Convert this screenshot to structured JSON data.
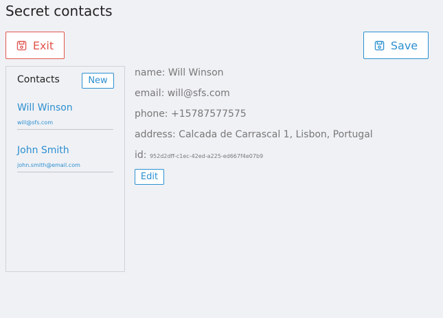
{
  "page": {
    "title": "Secret contacts"
  },
  "toolbar": {
    "exit_label": "Exit",
    "save_label": "Save",
    "exit_icon": "save-icon",
    "save_icon": "save-icon"
  },
  "sidebar": {
    "header": "Contacts",
    "new_label": "New",
    "contacts": [
      {
        "name": "Will Winson",
        "email": "will@sfs.com"
      },
      {
        "name": "John Smith",
        "email": "john.smith@email.com"
      }
    ]
  },
  "details": {
    "name_label": "name:",
    "name_value": "Will Winson",
    "email_label": "email:",
    "email_value": "will@sfs.com",
    "phone_label": "phone:",
    "phone_value": "+15787577575",
    "address_label": "address:",
    "address_value": "Calcada de Carrascal 1, Lisbon, Portugal",
    "id_label": "id:",
    "id_value": "952d2dff-c1ec-42ed-a225-ed667f4e07b9",
    "edit_label": "Edit"
  },
  "colors": {
    "accent": "#2b8fd0",
    "danger": "#e0554d",
    "background": "#f0f1f5"
  }
}
